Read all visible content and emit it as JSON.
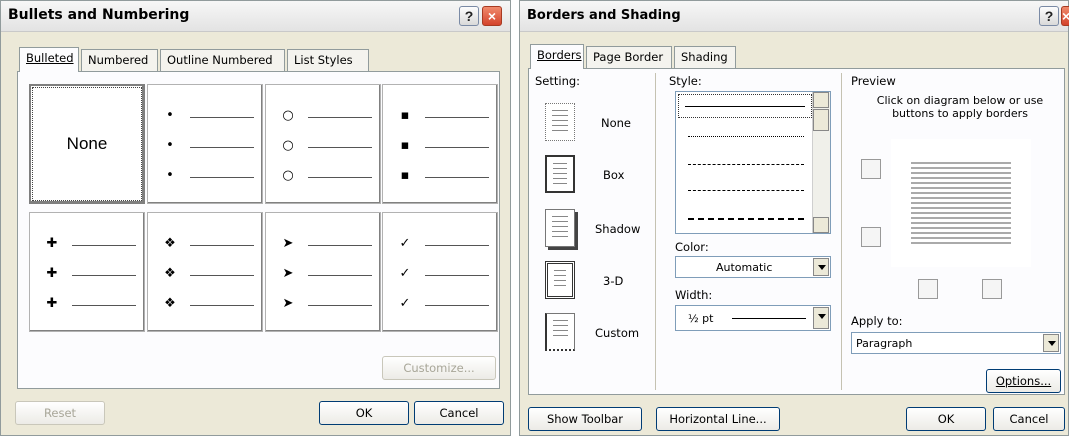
{
  "bullets_dialog": {
    "title": "Bullets and Numbering",
    "help_symbol": "?",
    "close_symbol": "×",
    "tabs": [
      "Bulleted",
      "Numbered",
      "Outline Numbered",
      "List Styles"
    ],
    "none_label": "None",
    "styles": [
      {
        "symbol": "•"
      },
      {
        "symbol": "○"
      },
      {
        "symbol": "▪"
      },
      {
        "symbol": "✚"
      },
      {
        "symbol": "❖"
      },
      {
        "symbol": "➤"
      },
      {
        "symbol": "✓"
      }
    ],
    "customize_label": "Customize...",
    "reset_label": "Reset",
    "ok_label": "OK",
    "cancel_label": "Cancel"
  },
  "borders_dialog": {
    "title": "Borders and Shading",
    "help_symbol": "?",
    "close_symbol": "×",
    "tabs": [
      "Borders",
      "Page Border",
      "Shading"
    ],
    "setting_label": "Setting:",
    "settings": [
      "None",
      "Box",
      "Shadow",
      "3-D",
      "Custom"
    ],
    "style_label": "Style:",
    "color_label": "Color:",
    "color_value": "Automatic",
    "width_label": "Width:",
    "width_value": "½ pt",
    "preview_label": "Preview",
    "preview_hint": "Click on diagram below or use buttons to apply borders",
    "apply_to_label": "Apply to:",
    "apply_to_value": "Paragraph",
    "options_label": "Options...",
    "show_toolbar_label": "Show Toolbar",
    "horizontal_line_label": "Horizontal Line...",
    "ok_label": "OK",
    "cancel_label": "Cancel"
  }
}
